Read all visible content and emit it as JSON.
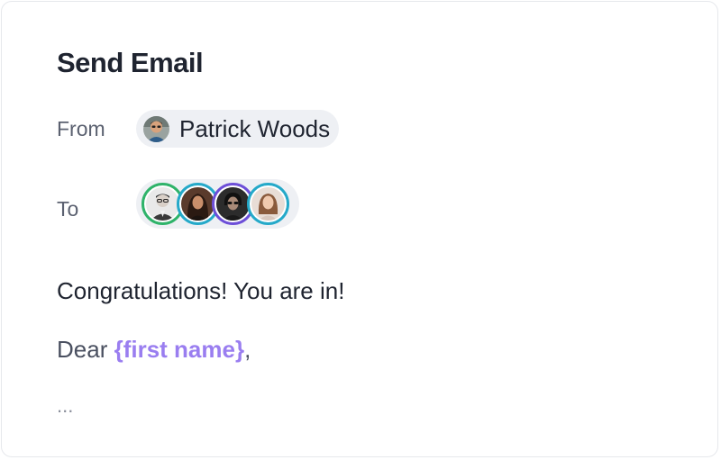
{
  "compose": {
    "title": "Send Email",
    "from_label": "From",
    "to_label": "To",
    "sender": {
      "name": "Patrick Woods",
      "avatar_icon": "sender-avatar-photo"
    },
    "recipients": [
      {
        "avatar_icon": "recipient-avatar-photo",
        "ring_color": "#2fb36a"
      },
      {
        "avatar_icon": "recipient-avatar-photo",
        "ring_color": "#25a9c9"
      },
      {
        "avatar_icon": "recipient-avatar-photo",
        "ring_color": "#6d4fd8"
      },
      {
        "avatar_icon": "recipient-avatar-photo",
        "ring_color": "#25a9c9"
      }
    ]
  },
  "message": {
    "subject": "Congratulations! You are in!",
    "greeting_prefix": "Dear ",
    "placeholder": "{first name}",
    "greeting_suffix": ",",
    "ellipsis": "..."
  },
  "colors": {
    "placeholder": "#9a7ef0",
    "chip_background": "#eef0f4",
    "text_primary": "#1f2430"
  }
}
